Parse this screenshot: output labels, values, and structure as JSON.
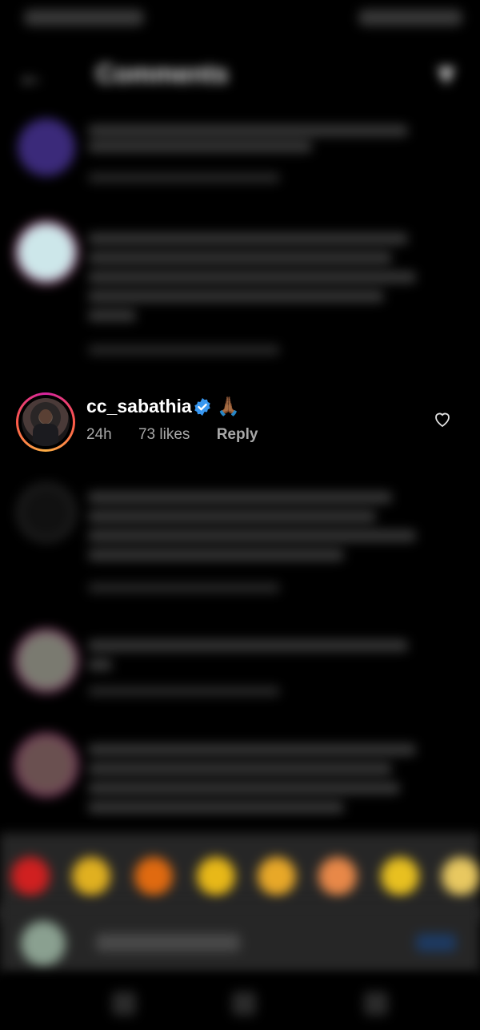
{
  "header": {
    "title": "Comments"
  },
  "focused_comment": {
    "username": "cc_sabathia",
    "emoji": "🙏🏾",
    "time": "24h",
    "likes": "73 likes",
    "reply_label": "Reply"
  },
  "icons": {
    "verified": "verified-badge-icon",
    "heart": "heart-outline-icon",
    "back": "back-arrow-icon",
    "filter": "filter-icon"
  },
  "colors": {
    "background": "#000000",
    "verified_blue": "#3897f0",
    "meta_gray": "#a8a8a8"
  },
  "reaction_emojis": [
    "❤️",
    "🙌",
    "🔥",
    "👏",
    "😢",
    "😍",
    "😮",
    "😂"
  ]
}
